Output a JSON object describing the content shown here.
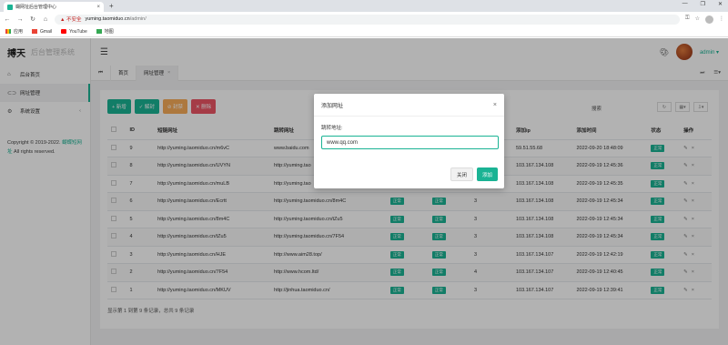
{
  "browser": {
    "tab_title": "蝴网址后台管理中心",
    "new_tab": "+",
    "warning": "▲ 不安全",
    "url_host": "yuming.taomiduo.cn",
    "url_path": "/admin/",
    "bookmarks": [
      "应用",
      "Gmail",
      "YouTube",
      "地图"
    ]
  },
  "sidebar": {
    "brand_main": "搏天",
    "brand_sub": "后台管理系统",
    "items": [
      {
        "label": "后台首页",
        "icon": "home-icon"
      },
      {
        "label": "网址管理",
        "icon": "link-icon"
      },
      {
        "label": "系统设置",
        "icon": "gear-icon"
      }
    ],
    "copyright_prefix": "Copyright © 2019-2022.",
    "copyright_link": "蝴蝶短网址",
    "copyright_suffix": " All rights reserved."
  },
  "topbar": {
    "admin_label": "admin ▾"
  },
  "page_tabs": {
    "home": "首页",
    "current": "网址管理"
  },
  "toolbar": {
    "add": "+ 新增",
    "enable": "✓ 解封",
    "disable": "⊘ 封禁",
    "delete": "✕ 删除",
    "search": "搜索"
  },
  "table": {
    "headers": [
      "",
      "ID",
      "短链网址",
      "跳转网址",
      "",
      "",
      "访问次数",
      "添加ip",
      "添加时间",
      "状态",
      "操作"
    ],
    "rows": [
      [
        "9",
        "http://yuming.taomiduo.cn/m6vC",
        "www.baidu.com",
        "",
        "",
        "",
        "59.51.55.68",
        "2022-09-20 18:48:09",
        "正常"
      ],
      [
        "8",
        "http://yuming.taomiduo.cn/UVYN",
        "http://yuming.tao",
        "",
        "",
        "",
        "103.167.134.108",
        "2022-09-19 12:45:36",
        "正常"
      ],
      [
        "7",
        "http://yuming.taomiduo.cn/muLB",
        "http://yuming.tao",
        "",
        "",
        "",
        "103.167.134.108",
        "2022-09-19 12:45:35",
        "正常"
      ],
      [
        "6",
        "http://yuming.taomiduo.cn/Ecrtt",
        "http://yuming.taomiduo.cn/8m4C",
        "正常",
        "正常",
        "3",
        "103.167.134.108",
        "2022-09-19 12:45:34",
        "正常"
      ],
      [
        "5",
        "http://yuming.taomiduo.cn/8m4C",
        "http://yuming.taomiduo.cn/tZu5",
        "正常",
        "正常",
        "3",
        "103.167.134.108",
        "2022-09-19 12:45:34",
        "正常"
      ],
      [
        "4",
        "http://yuming.taomiduo.cn/tZu5",
        "http://yuming.taomiduo.cn/7F54",
        "正常",
        "正常",
        "3",
        "103.167.134.108",
        "2022-09-19 12:45:34",
        "正常"
      ],
      [
        "3",
        "http://yuming.taomiduo.cn/HJE",
        "http://www.aim28.top/",
        "正常",
        "正常",
        "3",
        "103.167.134.107",
        "2022-09-19 12:42:19",
        "正常"
      ],
      [
        "2",
        "http://yuming.taomiduo.cn/7F54",
        "http://www.hcom.ltd/",
        "正常",
        "正常",
        "4",
        "103.167.134.107",
        "2022-09-19 12:40:45",
        "正常"
      ],
      [
        "1",
        "http://yuming.taomiduo.cn/MKUV",
        "http://jinhua.taomiduo.cn/",
        "正常",
        "正常",
        "3",
        "103.167.134.107",
        "2022-09-19 12:39:41",
        "正常"
      ]
    ],
    "footer": "显示第 1 到第 9 条记录，总共 9 条记录"
  },
  "modal": {
    "title": "添加网址",
    "close": "×",
    "label": "跳转地址:",
    "value": "www.qq.com",
    "cancel": "关闭",
    "submit": "添加"
  },
  "colors": {
    "accent": "#1ab394",
    "danger": "#ed5565",
    "warning": "#f8ac59"
  }
}
